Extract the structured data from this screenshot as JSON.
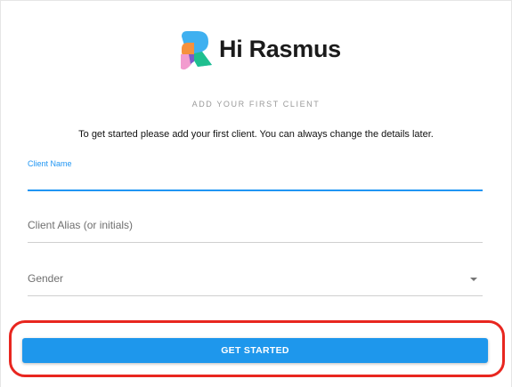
{
  "brand": {
    "name": "Hi Rasmus",
    "colors": {
      "mark_blue": "#3fb0f0",
      "mark_green": "#1fbf8f",
      "mark_orange": "#f5913e",
      "mark_pink": "#f29ccf",
      "mark_purple": "#7a5cc9"
    }
  },
  "onboarding": {
    "heading": "ADD YOUR FIRST CLIENT",
    "intro": "To get started please add your first client. You can always change the details later."
  },
  "form": {
    "client_name": {
      "label": "Client Name",
      "value": ""
    },
    "client_alias": {
      "placeholder": "Client Alias (or initials)"
    },
    "gender": {
      "placeholder": "Gender"
    }
  },
  "actions": {
    "get_started_label": "GET STARTED"
  },
  "theme": {
    "accent": "#2196f3",
    "button": "#1e97ec",
    "highlight_ring": "#e8261f"
  }
}
